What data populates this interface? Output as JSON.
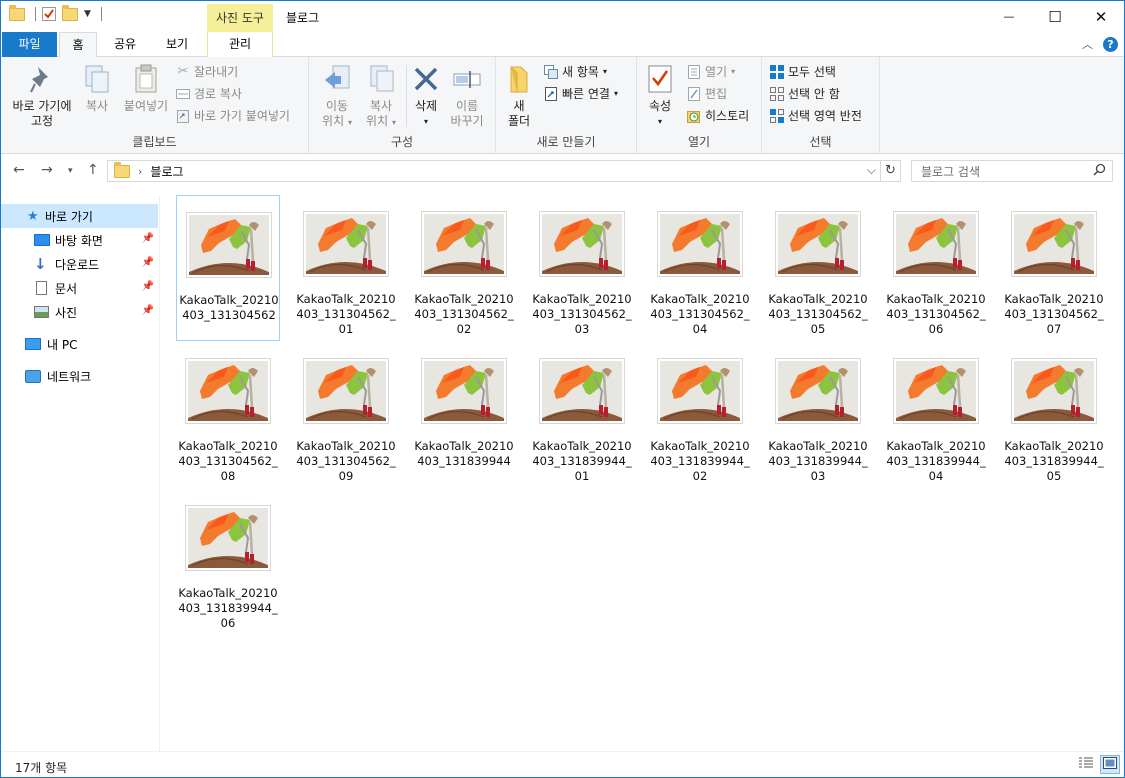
{
  "window": {
    "title": "블로그",
    "contextual_tab_group": "사진 도구"
  },
  "window_buttons": {
    "minimize": "—",
    "maximize": "☐",
    "close": "✕"
  },
  "tabs": {
    "file": "파일",
    "home": "홈",
    "share": "공유",
    "view": "보기",
    "manage": "관리"
  },
  "ribbon": {
    "clipboard": {
      "label": "클립보드",
      "pin_label_1": "바로 가기에",
      "pin_label_2": "고정",
      "copy": "복사",
      "paste": "붙여넣기",
      "cut": "잘라내기",
      "copy_path": "경로 복사",
      "paste_shortcut": "바로 가기 붙여넣기"
    },
    "organize": {
      "label": "구성",
      "move_1": "이동",
      "move_2": "위치",
      "copyto_1": "복사",
      "copyto_2": "위치",
      "delete": "삭제",
      "rename_1": "이름",
      "rename_2": "바꾸기"
    },
    "new": {
      "label": "새로 만들기",
      "new_folder_1": "새",
      "new_folder_2": "폴더",
      "new_item": "새 항목",
      "easy_access": "빠른 연결"
    },
    "open": {
      "label": "열기",
      "properties": "속성",
      "open": "열기",
      "edit": "편집",
      "history": "히스토리"
    },
    "select": {
      "label": "선택",
      "select_all": "모두 선택",
      "select_none": "선택 안 함",
      "invert": "선택 영역 반전"
    }
  },
  "address": {
    "crumb": "블로그",
    "search_placeholder": "블로그 검색"
  },
  "sidebar": {
    "quick_access": "바로 가기",
    "items": [
      {
        "label": "바탕 화면"
      },
      {
        "label": "다운로드"
      },
      {
        "label": "문서"
      },
      {
        "label": "사진"
      }
    ],
    "this_pc": "내 PC",
    "network": "네트워크"
  },
  "files": [
    {
      "name": "KakaoTalk_20210403_131304562"
    },
    {
      "name": "KakaoTalk_20210403_131304562_01"
    },
    {
      "name": "KakaoTalk_20210403_131304562_02"
    },
    {
      "name": "KakaoTalk_20210403_131304562_03"
    },
    {
      "name": "KakaoTalk_20210403_131304562_04"
    },
    {
      "name": "KakaoTalk_20210403_131304562_05"
    },
    {
      "name": "KakaoTalk_20210403_131304562_06"
    },
    {
      "name": "KakaoTalk_20210403_131304562_07"
    },
    {
      "name": "KakaoTalk_20210403_131304562_08"
    },
    {
      "name": "KakaoTalk_20210403_131304562_09"
    },
    {
      "name": "KakaoTalk_20210403_131839944"
    },
    {
      "name": "KakaoTalk_20210403_131839944_01"
    },
    {
      "name": "KakaoTalk_20210403_131839944_02"
    },
    {
      "name": "KakaoTalk_20210403_131839944_03"
    },
    {
      "name": "KakaoTalk_20210403_131839944_04"
    },
    {
      "name": "KakaoTalk_20210403_131839944_05"
    },
    {
      "name": "KakaoTalk_20210403_131839944_06"
    }
  ],
  "status": {
    "count": "17개 항목"
  },
  "colors": {
    "accent": "#1979ca",
    "selection": "#cce8ff",
    "context_tab": "#f5ef9a"
  }
}
